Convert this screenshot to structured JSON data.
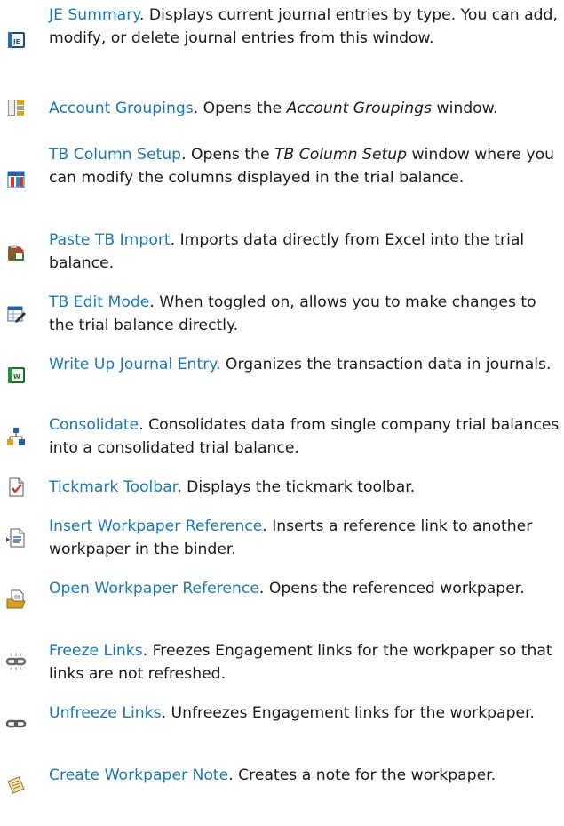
{
  "colors": {
    "link": "#1a78b5",
    "text": "#1a1a1a"
  },
  "items": [
    {
      "icon": "je-summary-icon",
      "term": "JE Summary",
      "desc": [
        {
          "t": ". Displays current journal entries by type. You can add, modify, or delete journal entries from this window."
        }
      ]
    },
    {
      "icon": "account-groupings-icon",
      "term": "Account Groupings",
      "desc": [
        {
          "t": ". Opens the "
        },
        {
          "t": "Account Groupings",
          "i": true
        },
        {
          "t": " window."
        }
      ]
    },
    {
      "icon": "tb-column-setup-icon",
      "term": "TB Column Setup",
      "desc": [
        {
          "t": ". Opens the "
        },
        {
          "t": "TB Column Setup",
          "i": true
        },
        {
          "t": " window where you can modify the columns displayed in the trial balance."
        }
      ]
    },
    {
      "icon": "paste-tb-import-icon",
      "term": "Paste TB Import",
      "desc": [
        {
          "t": ". Imports data directly from Excel into the trial balance."
        }
      ]
    },
    {
      "icon": "tb-edit-mode-icon",
      "term": "TB Edit Mode",
      "desc": [
        {
          "t": ". When toggled on, allows you to make changes to the trial balance directly."
        }
      ]
    },
    {
      "icon": "write-up-journal-entry-icon",
      "term": "Write Up Journal Entry",
      "desc": [
        {
          "t": ". Organizes the transaction data in journals."
        }
      ]
    },
    {
      "icon": "consolidate-icon",
      "term": "Consolidate",
      "desc": [
        {
          "t": ". Consolidates data from single company trial balances into a consolidated trial balance."
        }
      ]
    },
    {
      "icon": "tickmark-toolbar-icon",
      "term": "Tickmark Toolbar",
      "desc": [
        {
          "t": ". Displays the tickmark toolbar."
        }
      ]
    },
    {
      "icon": "insert-workpaper-reference-icon",
      "term": "Insert Workpaper Reference",
      "desc": [
        {
          "t": ". Inserts a reference link to another workpaper in the binder."
        }
      ]
    },
    {
      "icon": "open-workpaper-reference-icon",
      "term": "Open Workpaper Reference",
      "desc": [
        {
          "t": ". Opens the referenced workpaper."
        }
      ]
    },
    {
      "icon": "freeze-links-icon",
      "term": "Freeze Links",
      "desc": [
        {
          "t": ". Freezes Engagement links for the workpaper so that links are not refreshed."
        }
      ]
    },
    {
      "icon": "unfreeze-links-icon",
      "term": "Unfreeze Links",
      "desc": [
        {
          "t": ". Unfreezes Engagement links for the workpaper."
        }
      ]
    },
    {
      "icon": "create-workpaper-note-icon",
      "term": "Create Workpaper Note",
      "desc": [
        {
          "t": ". Creates a note for the workpaper."
        }
      ]
    }
  ]
}
